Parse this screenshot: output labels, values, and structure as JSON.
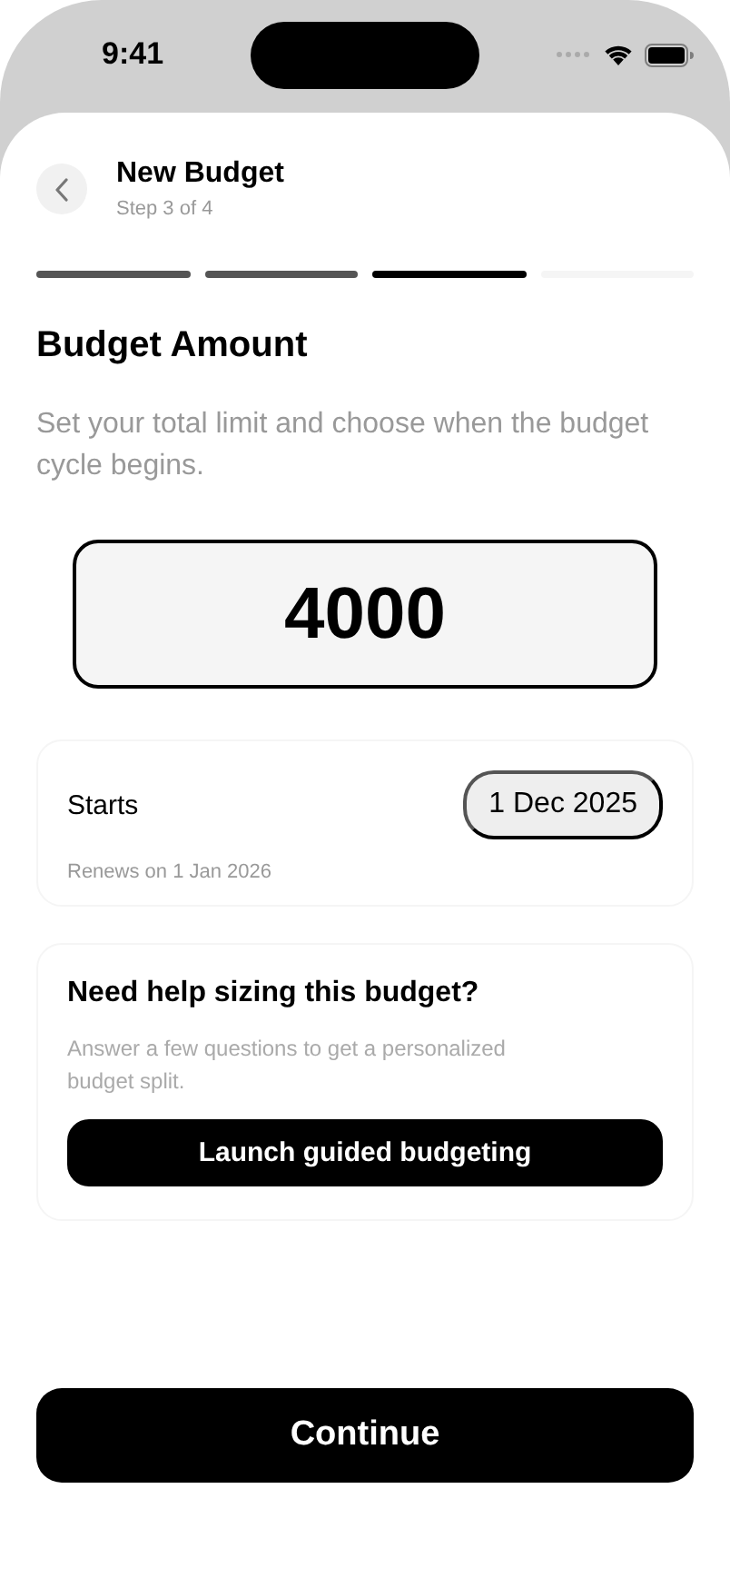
{
  "status_bar": {
    "time": "9:41"
  },
  "header": {
    "title": "New Budget",
    "subtitle": "Step 3 of 4"
  },
  "progress": [
    {
      "completed": true,
      "selected": false
    },
    {
      "completed": true,
      "selected": false
    },
    {
      "completed": false,
      "selected": true
    },
    {
      "completed": false,
      "selected": false
    }
  ],
  "section": {
    "title": "Budget Amount",
    "description": "Set your total limit and choose when the budget cycle begins."
  },
  "amount": {
    "value": "4000"
  },
  "start_card": {
    "label": "Starts",
    "date": "1 Dec 2025",
    "note": "Renews on 1 Jan 2026"
  },
  "help_card": {
    "title": "Need help sizing this budget?",
    "description": "Answer a few questions to get a personalized budget split.",
    "button": "Launch guided budgeting"
  },
  "primary_button": "Continue"
}
